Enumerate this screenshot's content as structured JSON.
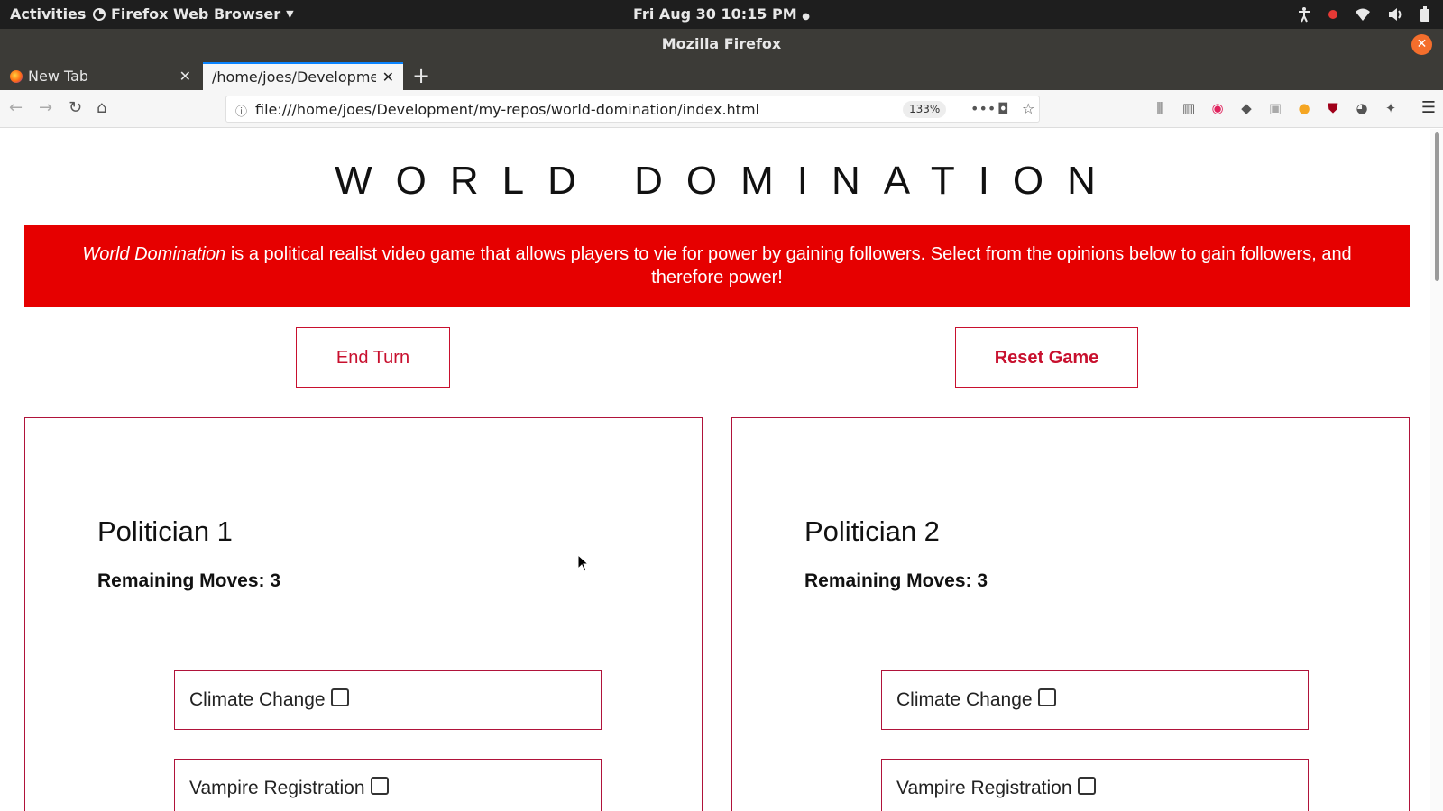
{
  "topbar": {
    "activities": "Activities",
    "app_menu": "Firefox Web Browser",
    "clock": "Fri Aug 30  10:15 PM"
  },
  "window": {
    "title": "Mozilla Firefox"
  },
  "tabs": [
    {
      "label": "New Tab"
    },
    {
      "label": "/home/joes/Developme"
    }
  ],
  "navbar": {
    "url": "file:///home/joes/Development/my-repos/world-domination/index.html",
    "zoom": "133%"
  },
  "page": {
    "title": "WORLD DOMINATION",
    "intro_italic": "World Domination",
    "intro_rest": " is a political realist video game that allows players to vie for power by gaining followers. Select from the opinions below to gain followers, and therefore power!",
    "end_turn_label": "End Turn",
    "reset_label": "Reset Game",
    "politicians": [
      {
        "name": "Politician 1",
        "moves": "Remaining Moves: 3",
        "opinions": [
          "Climate Change",
          "Vampire Registration"
        ]
      },
      {
        "name": "Politician 2",
        "moves": "Remaining Moves: 3",
        "opinions": [
          "Climate Change",
          "Vampire Registration"
        ]
      }
    ]
  },
  "colors": {
    "accent": "#e60000",
    "border": "#b0133a",
    "firefox_blue": "#0a84ff"
  }
}
